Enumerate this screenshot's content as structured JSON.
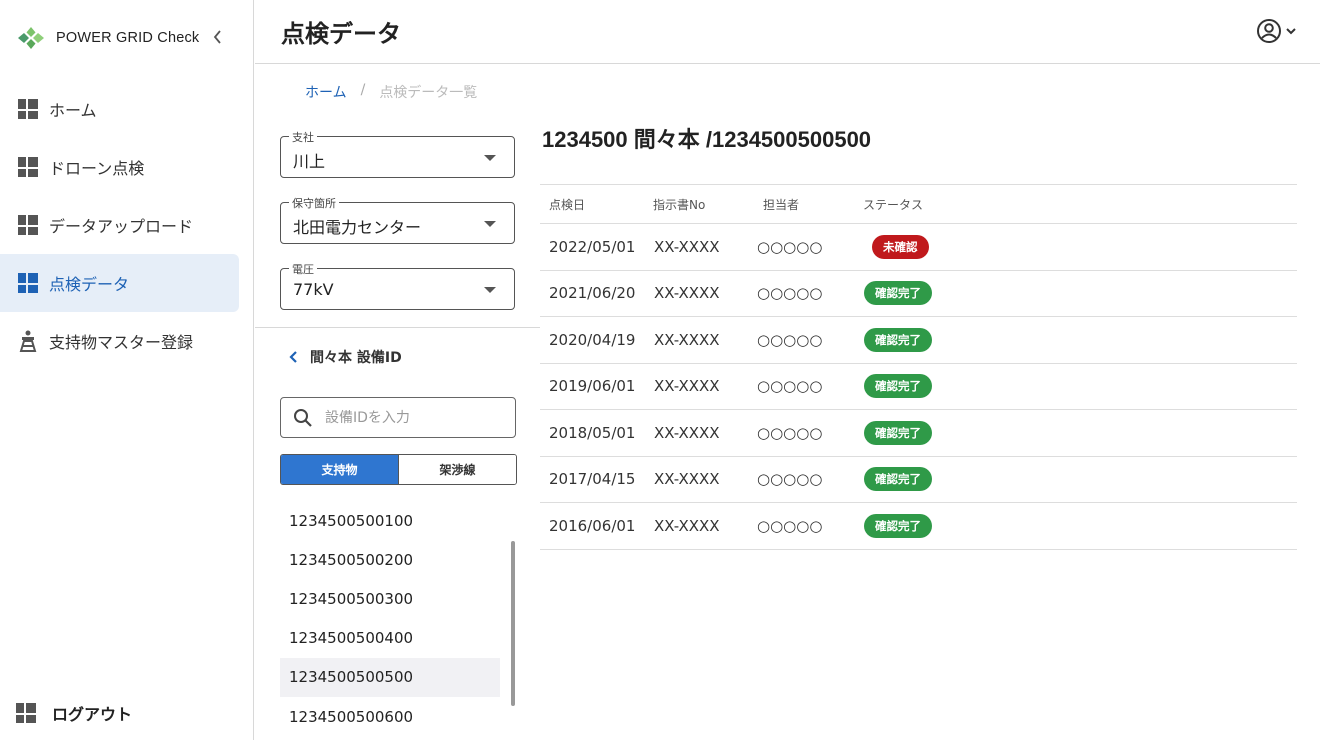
{
  "app": {
    "title": "POWER GRID Check",
    "colors": {
      "accent": "#1e62b5",
      "selected_bg": "#e6eef8",
      "segment_on": "#2f76d0",
      "badge_unconfirmed": "#c0191c",
      "badge_confirmed": "#2f9a48"
    }
  },
  "sidebar": {
    "items": [
      {
        "label": "ホーム",
        "icon": "dashboard-icon",
        "active": false
      },
      {
        "label": "ドローン点検",
        "icon": "dashboard-icon",
        "active": false
      },
      {
        "label": "データアップロード",
        "icon": "dashboard-icon",
        "active": false
      },
      {
        "label": "点検データ",
        "icon": "dashboard-icon",
        "active": true
      },
      {
        "label": "支持物マスター登録",
        "icon": "tower-icon",
        "active": false
      }
    ],
    "logout_label": "ログアウト"
  },
  "header": {
    "title": "点検データ",
    "user_icon": "account-circle-icon"
  },
  "breadcrumb": {
    "home": "ホーム",
    "separator": "/",
    "current": "点検データ一覧"
  },
  "filters": {
    "branch": {
      "label": "支社",
      "value": "川上"
    },
    "office": {
      "label": "保守箇所",
      "value": "北田電力センター"
    },
    "voltage": {
      "label": "電圧",
      "value": "77kV"
    }
  },
  "equipment": {
    "back_label": "間々本 設備ID",
    "search_placeholder": "設備IDを入力",
    "tabs": [
      {
        "label": "支持物",
        "active": true
      },
      {
        "label": "架渉線",
        "active": false
      }
    ],
    "ids": [
      {
        "id": "1234500500100",
        "selected": false
      },
      {
        "id": "1234500500200",
        "selected": false
      },
      {
        "id": "1234500500300",
        "selected": false
      },
      {
        "id": "1234500500400",
        "selected": false
      },
      {
        "id": "1234500500500",
        "selected": true
      },
      {
        "id": "1234500500600",
        "selected": false
      }
    ]
  },
  "detail": {
    "title": "1234500 間々本 /1234500500500",
    "columns": [
      "点検日",
      "指示書No",
      "担当者",
      "ステータス"
    ],
    "rows": [
      {
        "date": "2022/05/01",
        "order_no": "XX-XXXX",
        "person": "○○○○○",
        "status": "未確認"
      },
      {
        "date": "2021/06/20",
        "order_no": "XX-XXXX",
        "person": "○○○○○",
        "status": "確認完了"
      },
      {
        "date": "2020/04/19",
        "order_no": "XX-XXXX",
        "person": "○○○○○",
        "status": "確認完了"
      },
      {
        "date": "2019/06/01",
        "order_no": "XX-XXXX",
        "person": "○○○○○",
        "status": "確認完了"
      },
      {
        "date": "2018/05/01",
        "order_no": "XX-XXXX",
        "person": "○○○○○",
        "status": "確認完了"
      },
      {
        "date": "2017/04/15",
        "order_no": "XX-XXXX",
        "person": "○○○○○",
        "status": "確認完了"
      },
      {
        "date": "2016/06/01",
        "order_no": "XX-XXXX",
        "person": "○○○○○",
        "status": "確認完了"
      }
    ]
  }
}
